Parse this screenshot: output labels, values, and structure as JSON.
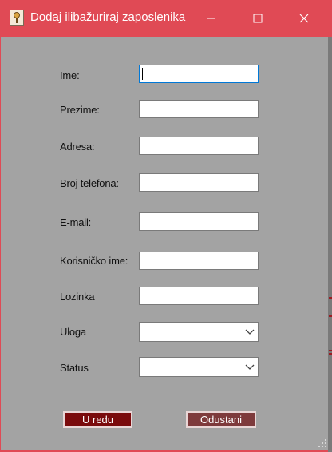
{
  "window": {
    "title": "Dodaj ilibažuriraj zaposlenika",
    "icon": "app-icon",
    "controls": [
      "minimize-icon",
      "maximize-icon",
      "close-icon"
    ]
  },
  "form": {
    "labels": {
      "ime": "Ime:",
      "prezime": "Prezime:",
      "adresa": "Adresa:",
      "telefon": "Broj telefona:",
      "email": "E-mail:",
      "korisnicko": "Korisničko ime:",
      "lozinka": "Lozinka",
      "uloga": "Uloga",
      "status": "Status"
    },
    "values": {
      "ime": "",
      "prezime": "",
      "adresa": "",
      "telefon": "",
      "email": "",
      "korisnicko": "",
      "lozinka": "",
      "uloga": "",
      "status": ""
    }
  },
  "buttons": {
    "ok": "U redu",
    "cancel": "Odustani"
  },
  "colors": {
    "titlebar": "#e04a55",
    "client": "#a3a3a3",
    "ok_button": "#7a0a0c",
    "cancel_button": "#7e3a3c"
  }
}
